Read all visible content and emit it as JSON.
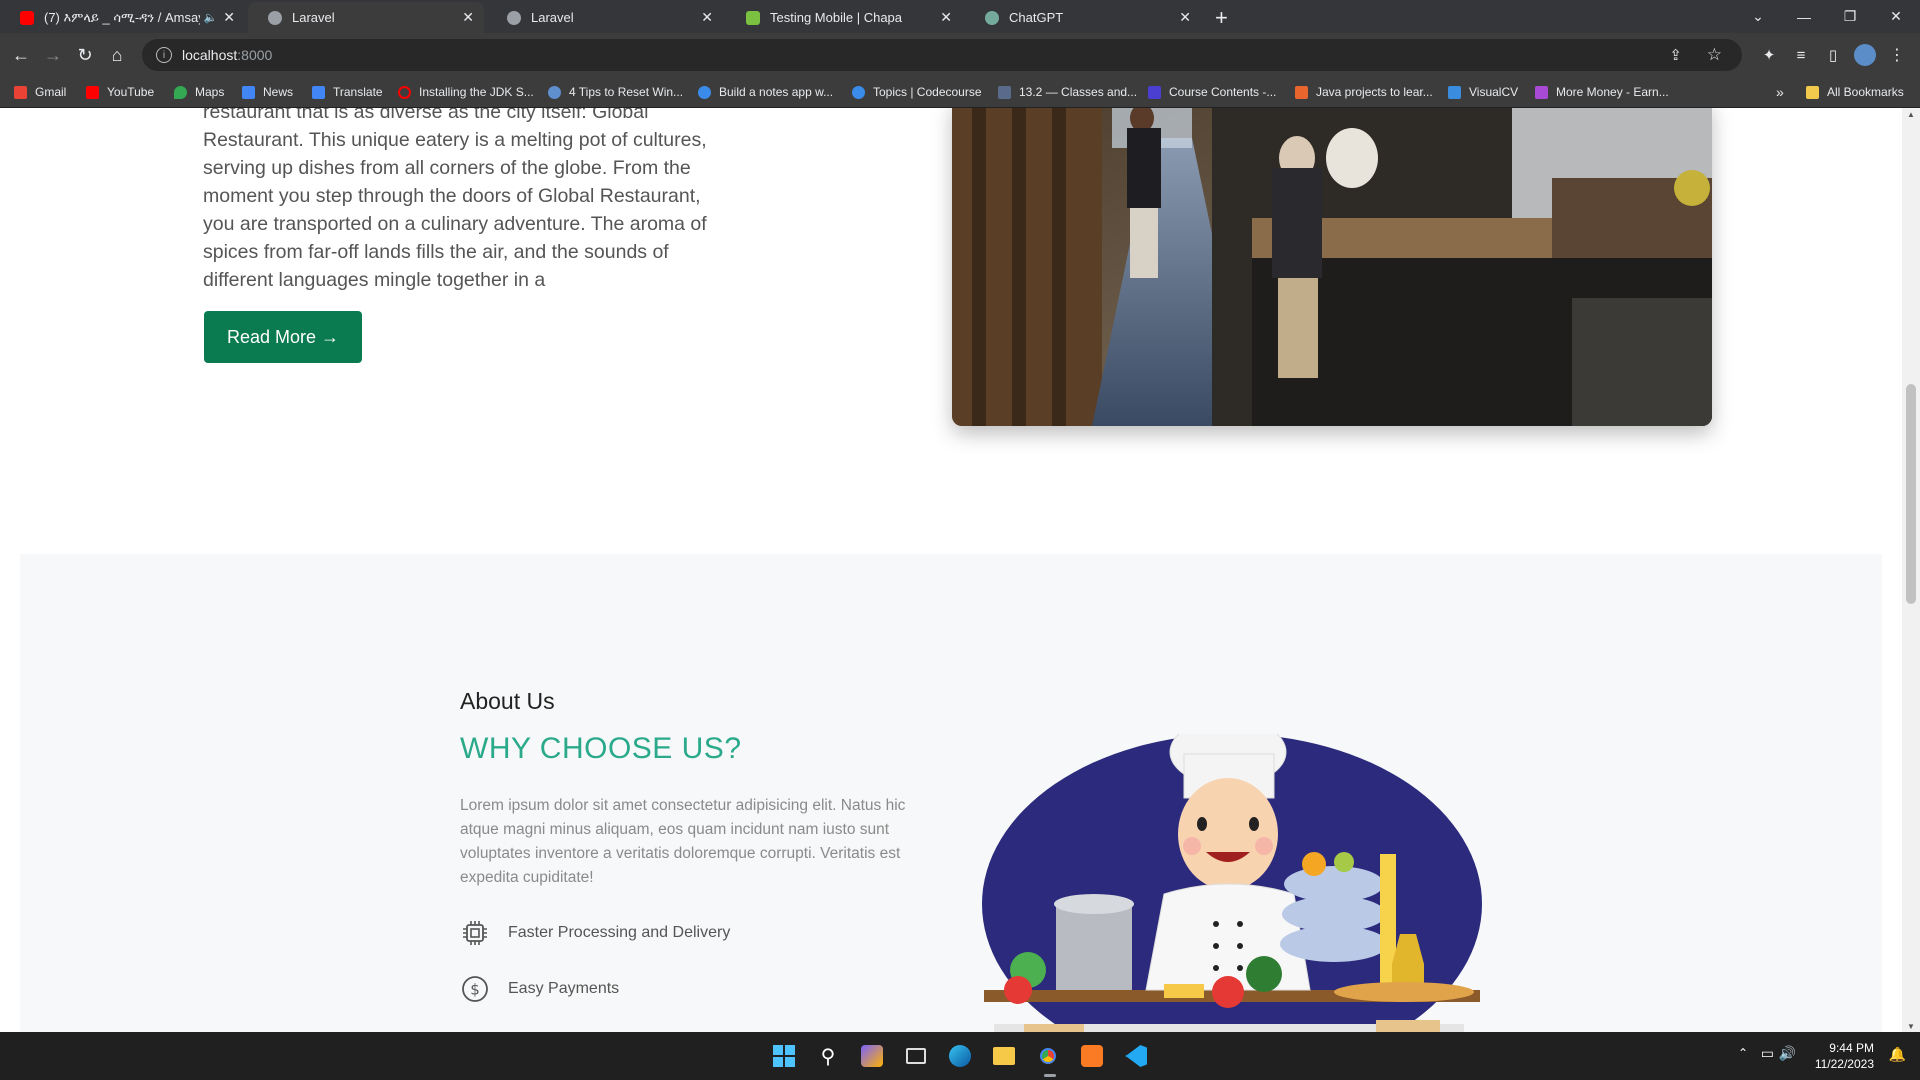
{
  "browser": {
    "tabs": [
      {
        "title": "(7) እምላይ _ ሳሚ-ዳን / Amsay",
        "active": false,
        "favicon": "youtube",
        "muted_icon": "speaker-icon"
      },
      {
        "title": "Laravel",
        "active": true,
        "favicon": "globe"
      },
      {
        "title": "Laravel",
        "active": false,
        "favicon": "globe"
      },
      {
        "title": "Testing Mobile | Chapa",
        "active": false,
        "favicon": "chapa"
      },
      {
        "title": "ChatGPT",
        "active": false,
        "favicon": "chatgpt"
      }
    ],
    "new_tab_label": "+",
    "address": {
      "host": "localhost",
      "port": ":8000"
    },
    "bookmarks": [
      {
        "label": "Gmail",
        "icon": "gmail"
      },
      {
        "label": "YouTube",
        "icon": "youtube"
      },
      {
        "label": "Maps",
        "icon": "maps"
      },
      {
        "label": "News",
        "icon": "news"
      },
      {
        "label": "Translate",
        "icon": "translate"
      },
      {
        "label": "Installing the JDK S...",
        "icon": "oracle"
      },
      {
        "label": "4 Tips to Reset Win...",
        "icon": "d"
      },
      {
        "label": "Build a notes app w...",
        "icon": "circle-blue"
      },
      {
        "label": "Topics | Codecourse",
        "icon": "circle-blue"
      },
      {
        "label": "13.2 — Classes and...",
        "icon": "cpp"
      },
      {
        "label": "Course Contents -...",
        "icon": "terminal"
      },
      {
        "label": "Java projects to lear...",
        "icon": "java"
      },
      {
        "label": "VisualCV",
        "icon": "visualcv"
      },
      {
        "label": "More Money - Earn...",
        "icon": "money"
      }
    ],
    "overflow_label": "»",
    "all_bookmarks_label": "All Bookmarks"
  },
  "page": {
    "intro_text": "restaurant that is as diverse as the city itself: Global Restaurant. This unique eatery is a melting pot of cultures, serving up dishes from all corners of the globe. From the moment you step through the doors of Global Restaurant, you are transported on a culinary adventure. The aroma of spices from far-off lands fills the air, and the sounds of different languages mingle together in a",
    "read_more_label": "Read More →",
    "about": {
      "label": "About Us",
      "title": "WHY CHOOSE US?",
      "body": "Lorem ipsum dolor sit amet consectetur adipisicing elit. Natus hic atque magni minus aliquam, eos quam incidunt nam iusto sunt voluptates inventore a veritatis doloremque corrupti. Veritatis est expedita cupiditate!",
      "features": [
        {
          "label": "Faster Processing and Delivery",
          "icon": "cpu-chip-icon"
        },
        {
          "label": "Easy Payments",
          "icon": "dollar-circle-icon"
        }
      ]
    }
  },
  "taskbar": {
    "time": "9:44 PM",
    "date": "11/22/2023"
  },
  "colors": {
    "accent_green": "#0a7a51",
    "title_teal": "#2aa98b",
    "chef_bg": "#2b2a7c"
  }
}
